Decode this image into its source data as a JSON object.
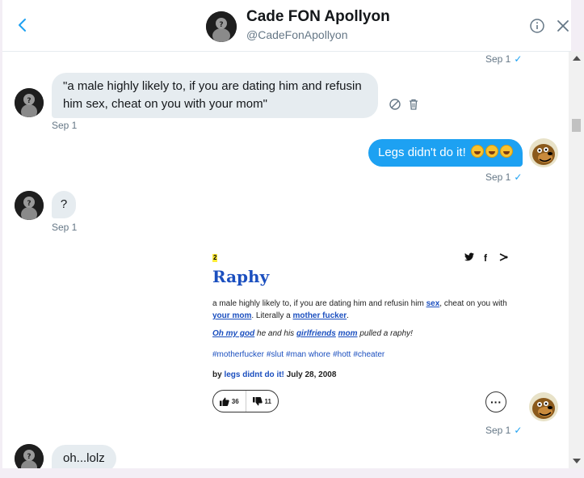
{
  "header": {
    "name": "Cade FON Apollyon",
    "handle": "@CadeFonApollyon"
  },
  "messages": {
    "top_meta": {
      "time": "Sep 1",
      "check": "✓"
    },
    "m1": {
      "text": "\"a male highly likely to, if you are dating him and refusin him sex, cheat on you with your mom\"",
      "time": "Sep 1"
    },
    "m2": {
      "text": "Legs didn't do it! ",
      "time": "Sep 1",
      "check": "✓"
    },
    "m3": {
      "text": "?",
      "time": "Sep 1"
    },
    "m4": {
      "time": "Sep 1",
      "check": "✓"
    },
    "m5": {
      "text": "oh...lolz"
    }
  },
  "card": {
    "badge": "2",
    "title": "Raphy",
    "share": {
      "twitter": "𝕥",
      "facebook": "f",
      "share": "⋗"
    },
    "definition": {
      "part1": "a male highly likely to, if you are dating him and refusin him ",
      "link1": "sex",
      "part2": ", cheat on you with ",
      "link2": "your mom",
      "part3": ". Literally a ",
      "link3": "mother fucker",
      "part4": "."
    },
    "example": {
      "link1": "Oh my god",
      "part1": " he and his ",
      "link2": "girlfriends",
      "part2": " ",
      "link3": "mom",
      "part3": " pulled a raphy!"
    },
    "tags": [
      "#motherfucker",
      "#slut",
      "#man whore",
      "#hott",
      "#cheater"
    ],
    "byline": {
      "by": "by ",
      "author": "legs didnt do it!",
      "date": " July 28, 2008"
    },
    "votes": {
      "up": "36",
      "down": "11"
    },
    "more": "···"
  },
  "colors": {
    "accent": "#1da1f2",
    "link": "#1b4fbf"
  }
}
